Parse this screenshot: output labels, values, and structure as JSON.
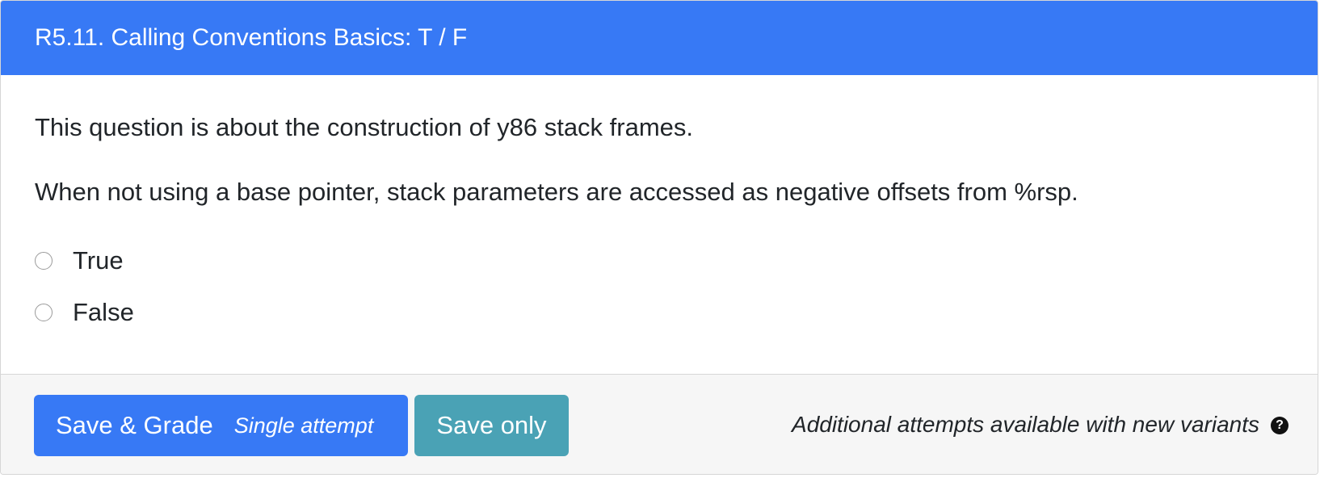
{
  "header": {
    "title": "R5.11. Calling Conventions Basics: T / F"
  },
  "question": {
    "intro": "This question is about the construction of y86 stack frames.",
    "statement": "When not using a base pointer, stack parameters are accessed as negative offsets from %rsp.",
    "options": [
      {
        "label": "True",
        "selected": false
      },
      {
        "label": "False",
        "selected": false
      }
    ]
  },
  "footer": {
    "grade_button_label": "Save & Grade",
    "grade_button_sublabel": "Single attempt",
    "save_button_label": "Save only",
    "attempts_note": "Additional attempts available with new variants",
    "help_icon_glyph": "?"
  },
  "colors": {
    "primary": "#3779f5",
    "info": "#4aa2b5",
    "footer_bg": "#f6f6f6"
  }
}
